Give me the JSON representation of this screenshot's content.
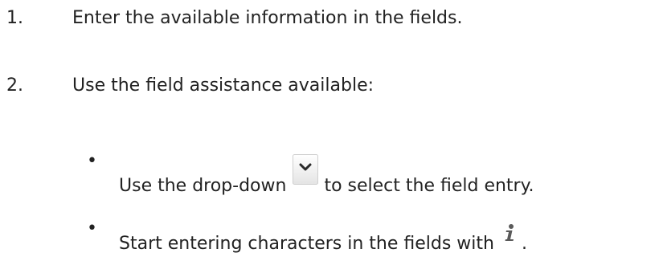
{
  "steps": [
    {
      "number": "1.",
      "text": "Enter the available information in the fields."
    },
    {
      "number": "2.",
      "text": "Use the field assistance available:"
    }
  ],
  "bullets": [
    {
      "marker": "•",
      "before": "Use the drop-down",
      "icon": "dropdown-icon",
      "after": "to select the field entry."
    },
    {
      "marker": "•",
      "before": "Start entering characters in the fields with",
      "icon": "info-icon",
      "after": "."
    }
  ]
}
